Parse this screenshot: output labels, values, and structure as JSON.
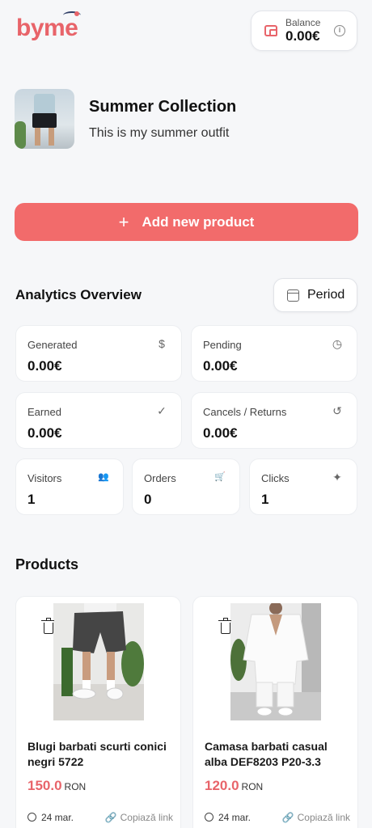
{
  "brand": {
    "logo_text": "byme",
    "accent": "#e8646a"
  },
  "header": {
    "balance_label": "Balance",
    "balance_value": "0.00€",
    "wallet_icon": "wallet-icon",
    "info_icon": "info-icon"
  },
  "collection": {
    "title": "Summer Collection",
    "description": "This is my summer outfit"
  },
  "actions": {
    "add_product_label": "Add new product",
    "add_icon": "+"
  },
  "analytics": {
    "title": "Analytics Overview",
    "period_label": "Period",
    "cards": [
      {
        "label": "Generated",
        "value": "0.00€",
        "icon": "$"
      },
      {
        "label": "Pending",
        "value": "0.00€",
        "icon": "◷"
      },
      {
        "label": "Earned",
        "value": "0.00€",
        "icon": "✓"
      },
      {
        "label": "Cancels / Returns",
        "value": "0.00€",
        "icon": "↺"
      },
      {
        "label": "Visitors",
        "value": "1",
        "icon": "👥"
      },
      {
        "label": "Orders",
        "value": "0",
        "icon": "🛒"
      },
      {
        "label": "Clicks",
        "value": "1",
        "icon": "✦"
      }
    ]
  },
  "products": {
    "title": "Products",
    "items": [
      {
        "name": "Blugi barbati scurti conici negri 5722",
        "price": "150.0",
        "currency": "RON",
        "date": "24 mar.",
        "link_label": "Copiază link"
      },
      {
        "name": "Camasa barbati casual alba DEF8203 P20-3.3",
        "price": "120.0",
        "currency": "RON",
        "date": "24 mar.",
        "link_label": "Copiază link"
      }
    ]
  }
}
